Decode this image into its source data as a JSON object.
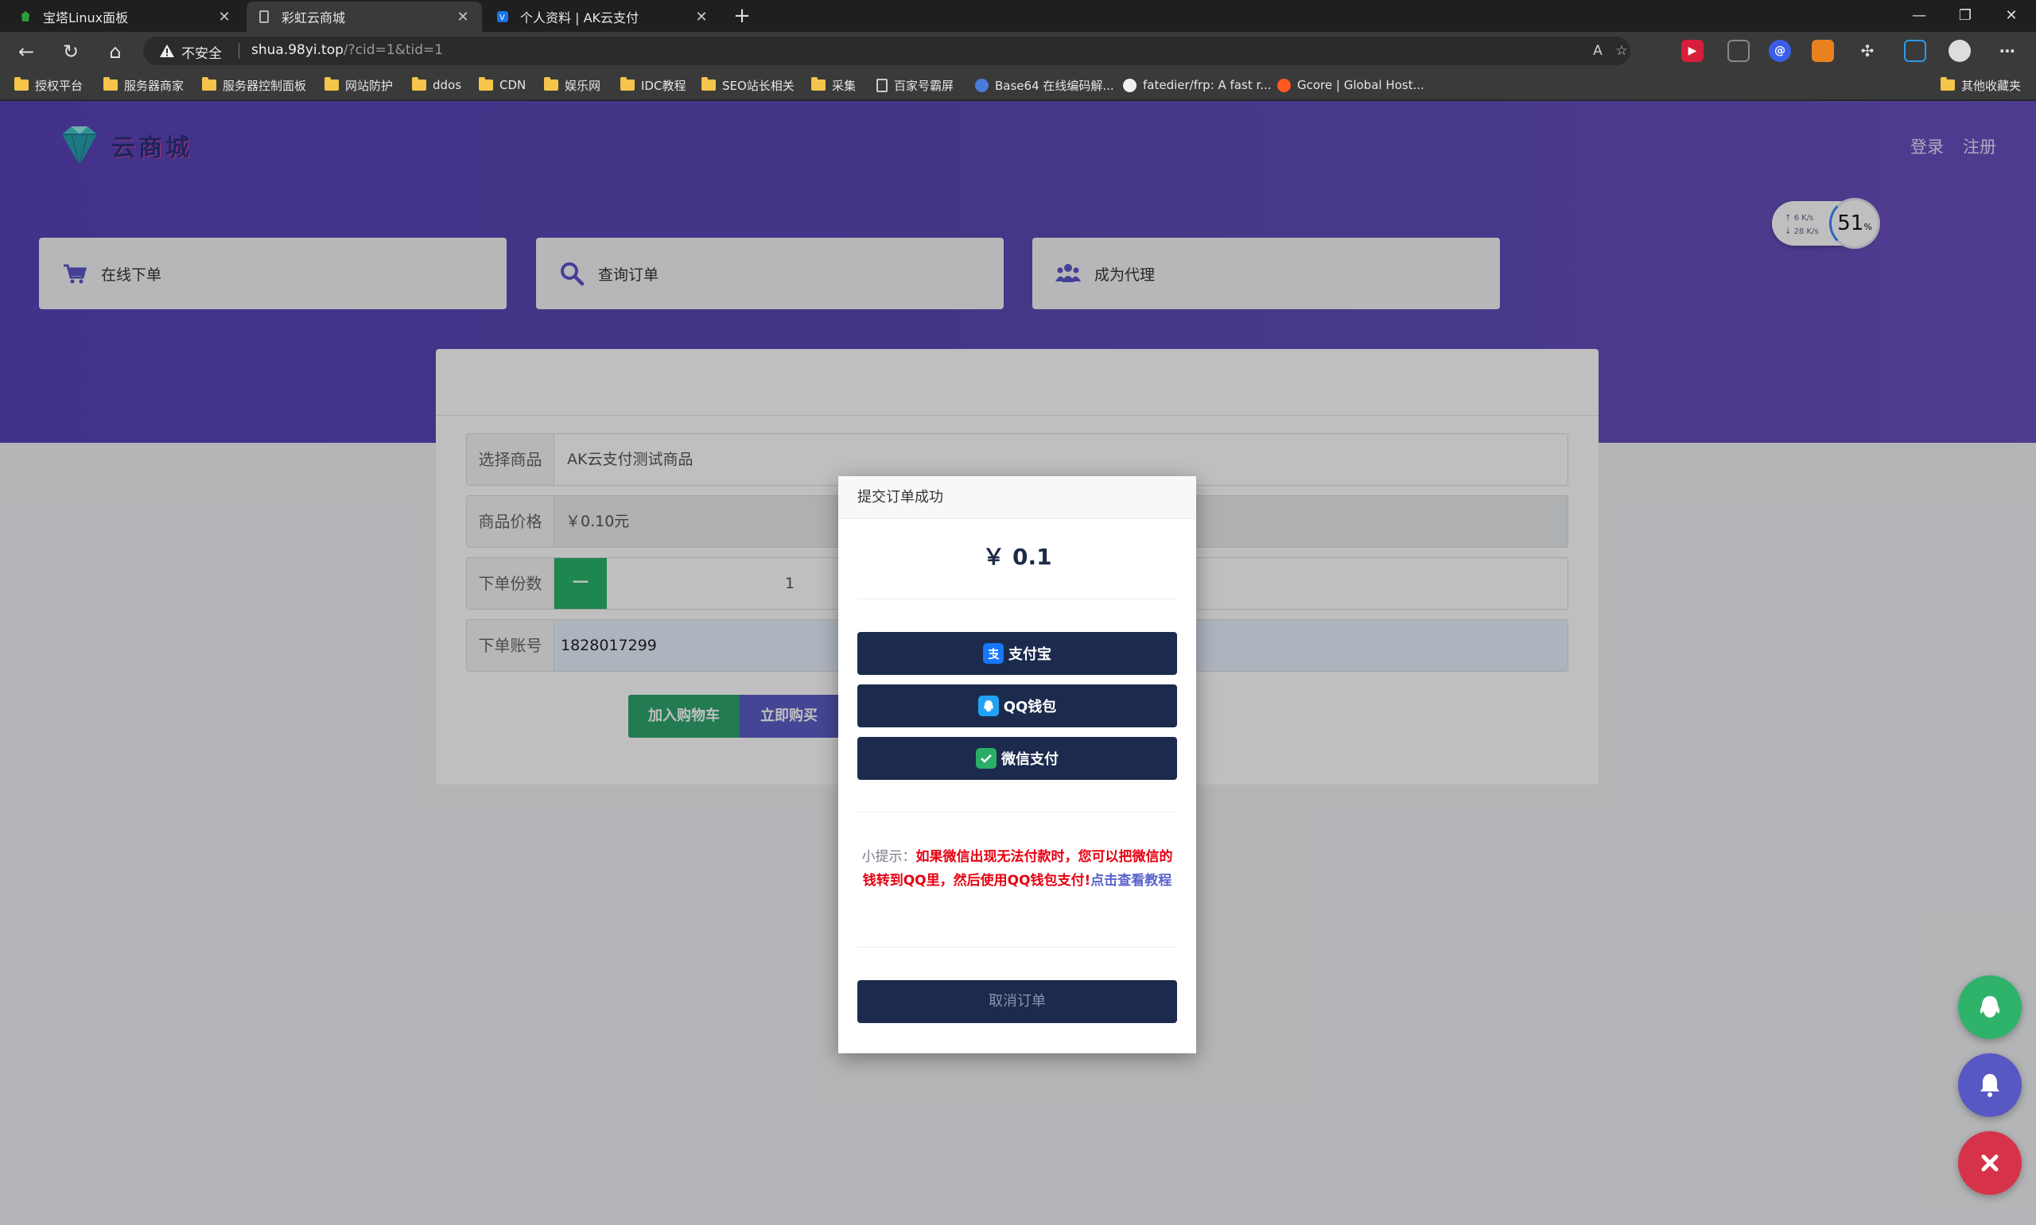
{
  "browser": {
    "tabs": [
      {
        "title": "宝塔Linux面板",
        "active": false
      },
      {
        "title": "彩虹云商城",
        "active": true
      },
      {
        "title": "个人资料 | AK云支付",
        "active": false
      }
    ],
    "new_tab": "+",
    "window_controls": {
      "minimize": "—",
      "restore": "❐",
      "close": "✕"
    },
    "address": {
      "security_label": "不安全",
      "url_host": "shua.98yi.top",
      "url_rest": "/?cid=1&tid=1"
    },
    "bookmarks": [
      {
        "label": "授权平台",
        "icon": "folder"
      },
      {
        "label": "服务器商家",
        "icon": "folder"
      },
      {
        "label": "服务器控制面板",
        "icon": "folder"
      },
      {
        "label": "网站防护",
        "icon": "folder"
      },
      {
        "label": "ddos",
        "icon": "folder"
      },
      {
        "label": "CDN",
        "icon": "folder"
      },
      {
        "label": "娱乐网",
        "icon": "folder"
      },
      {
        "label": "IDC教程",
        "icon": "folder"
      },
      {
        "label": "SEO站长相关",
        "icon": "folder"
      },
      {
        "label": "采集",
        "icon": "folder"
      },
      {
        "label": "百家号霸屏",
        "icon": "page"
      },
      {
        "label": "Base64 在线编码解...",
        "icon": "page"
      },
      {
        "label": "fatedier/frp: A fast r...",
        "icon": "github"
      },
      {
        "label": "Gcore | Global Host...",
        "icon": "gcore"
      }
    ],
    "other_bookmarks": "其他收藏夹"
  },
  "site": {
    "logo_text": "云商城",
    "nav": {
      "login": "登录",
      "register": "注册"
    },
    "cards": [
      {
        "label": "在线下单",
        "icon": "cart-icon"
      },
      {
        "label": "查询订单",
        "icon": "search-icon"
      },
      {
        "label": "成为代理",
        "icon": "users-icon"
      }
    ],
    "speed_widget": {
      "up": "6 K/s",
      "down": "28 K/s",
      "percent": "51",
      "unit": "%"
    },
    "form": {
      "product_label": "选择商品",
      "product_value": "AK云支付测试商品",
      "price_label": "商品价格",
      "price_value": "￥0.10元",
      "qty_label": "下单份数",
      "qty_minus": "−",
      "qty_value": "1",
      "account_label": "下单账号",
      "account_value": "1828017299",
      "add_cart": "加入购物车",
      "buy_now": "立即购买"
    }
  },
  "modal": {
    "title": "提交订单成功",
    "price": "￥ 0.1",
    "pay_methods": [
      {
        "label": "支付宝",
        "icon": "alipay-icon",
        "color": "#1677ff"
      },
      {
        "label": "QQ钱包",
        "icon": "qq-wallet-icon",
        "color": "#21a3f4"
      },
      {
        "label": "微信支付",
        "icon": "wechat-pay-icon",
        "color": "#2aae67"
      }
    ],
    "tip_prefix": "小提示：",
    "tip_red": "如果微信出现无法付款时，您可以把微信的钱转到QQ里，然后使用QQ钱包支付!",
    "tip_link": "点击查看教程",
    "cancel": "取消订单"
  },
  "colors": {
    "hero": "#5a43b8",
    "button_dark": "#1c2b4d",
    "green": "#28b46b",
    "red_tip": "#e60012"
  }
}
